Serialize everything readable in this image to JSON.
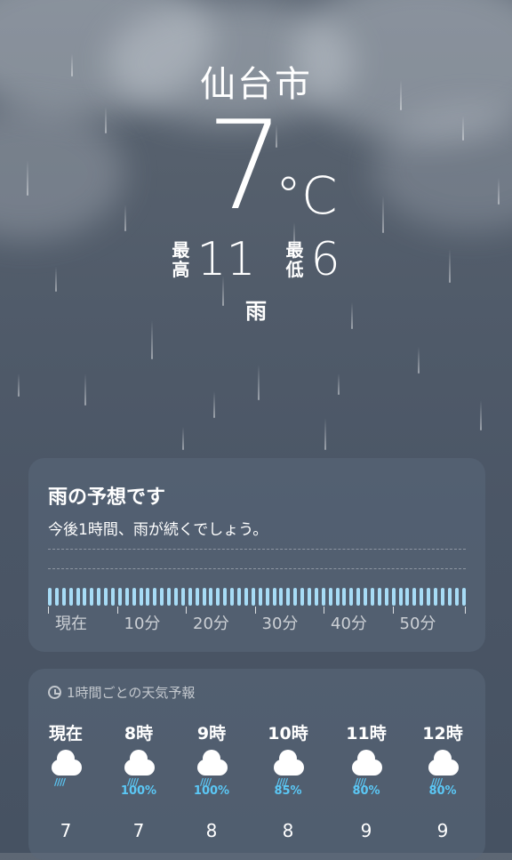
{
  "location": {
    "city": "仙台市"
  },
  "current": {
    "temperature": "7",
    "unit": "°C",
    "high_label": "最高",
    "high": "11",
    "low_label": "最低",
    "low": "6",
    "condition": "雨"
  },
  "precip_card": {
    "title": "雨の予想です",
    "subtitle": "今後1時間、雨が続くでしょう。",
    "time_labels": [
      "現在",
      "10分",
      "20分",
      "30分",
      "40分",
      "50分"
    ],
    "intensity_levels": [
      1,
      1,
      1,
      1,
      1,
      1,
      1,
      1,
      1,
      1,
      1,
      1,
      1,
      1,
      1,
      1,
      1,
      1,
      1,
      1,
      1,
      1,
      1,
      1,
      1,
      1,
      1,
      1,
      1,
      1,
      1,
      1,
      1,
      1,
      1,
      1,
      1,
      1,
      1,
      1,
      1,
      1,
      1,
      1,
      1,
      1,
      1,
      1,
      1,
      1,
      1,
      1,
      1,
      1,
      1,
      1,
      1,
      1,
      1,
      1
    ],
    "bar_color": "#a7dcf6"
  },
  "hourly_card": {
    "header": "1時間ごとの天気予報",
    "hours": [
      {
        "label": "現在",
        "icon": "rain-cloud-icon",
        "precip": "",
        "temp": "7"
      },
      {
        "label": "8時",
        "icon": "rain-cloud-icon",
        "precip": "100%",
        "temp": "7"
      },
      {
        "label": "9時",
        "icon": "rain-cloud-icon",
        "precip": "100%",
        "temp": "8"
      },
      {
        "label": "10時",
        "icon": "rain-cloud-icon",
        "precip": "85%",
        "temp": "8"
      },
      {
        "label": "11時",
        "icon": "rain-cloud-icon",
        "precip": "80%",
        "temp": "9"
      },
      {
        "label": "12時",
        "icon": "rain-cloud-icon",
        "precip": "80%",
        "temp": "9"
      }
    ],
    "accent_color": "#5bc8f6"
  }
}
